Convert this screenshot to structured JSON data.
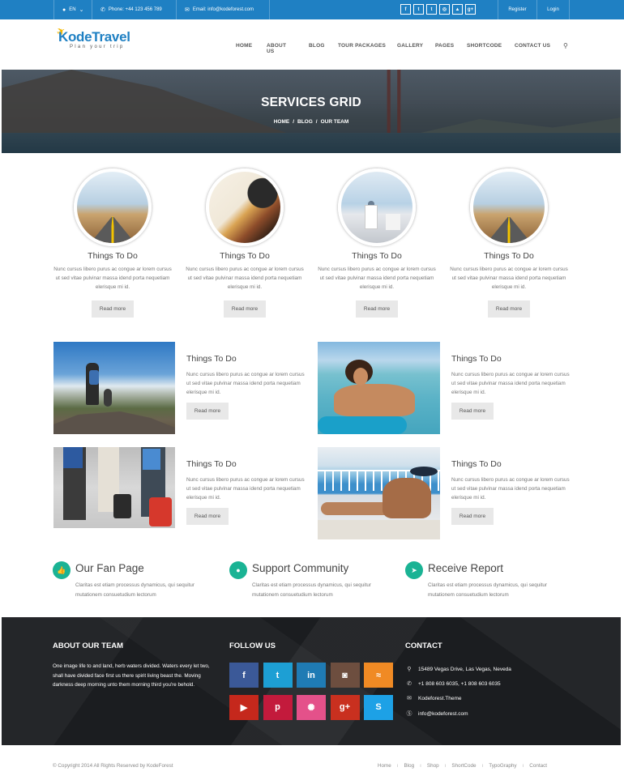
{
  "topbar": {
    "lang": "EN",
    "phone": "Phone: +44 123 456 789",
    "email": "Email: info@kodeforest.com",
    "socials": [
      "f",
      "t",
      "t",
      "◎",
      "▲",
      "g+"
    ],
    "register": "Register",
    "login": "Login"
  },
  "header": {
    "logo_word": "KodeTravel",
    "logo_tagline": "Plan your trip",
    "nav": [
      "HOME",
      "ABOUT US",
      "BLOG",
      "TOUR PACKAGES",
      "GALLERY",
      "PAGES",
      "SHORTCODE",
      "CONTACT US"
    ]
  },
  "hero": {
    "title": "SERVICES GRID",
    "breadcrumb": [
      "HOME",
      "BLOG",
      "OUR TEAM"
    ]
  },
  "circle_cards": [
    {
      "title": "Things To Do",
      "text": "Nunc cursus libero purus ac congue ar lorem cursus ut sed vitae pulvinar massa idend porta nequetiam elerisque mi id.",
      "button": "Read more"
    },
    {
      "title": "Things To Do",
      "text": "Nunc cursus libero purus ac congue ar lorem cursus ut sed vitae pulvinar massa idend porta nequetiam elerisque mi id.",
      "button": "Read more"
    },
    {
      "title": "Things To Do",
      "text": "Nunc cursus libero purus ac congue ar lorem cursus ut sed vitae pulvinar massa idend porta nequetiam elerisque mi id.",
      "button": "Read more"
    },
    {
      "title": "Things To Do",
      "text": "Nunc cursus libero purus ac congue ar lorem cursus ut sed vitae pulvinar massa idend porta nequetiam elerisque mi id.",
      "button": "Read more"
    }
  ],
  "image_cards": [
    {
      "title": "Things To Do",
      "text": "Nunc cursus libero purus ac congue ar lorem cursus ut sed vitae pulvinar massa idend porta nequetiam elerisque mi id.",
      "button": "Read more"
    },
    {
      "title": "Things To Do",
      "text": "Nunc cursus libero purus ac congue ar lorem cursus ut sed vitae pulvinar massa idend porta nequetiam elerisque mi id.",
      "button": "Read more"
    },
    {
      "title": "Things To Do",
      "text": "Nunc cursus libero purus ac congue ar lorem cursus ut sed vitae pulvinar massa idend porta nequetiam elerisque mi id.",
      "button": "Read more"
    },
    {
      "title": "Things To Do",
      "text": "Nunc cursus libero purus ac congue ar lorem cursus ut sed vitae pulvinar massa idend porta nequetiam elerisque mi id.",
      "button": "Read more"
    }
  ],
  "features": [
    {
      "icon": "thumbs-up-icon",
      "title": "Our Fan Page",
      "text": "Claritas est etiam processus dynamicus, qui sequitur mutationem consuetudium lectorum"
    },
    {
      "icon": "chat-bubble-icon",
      "title": "Support Community",
      "text": "Claritas est etiam processus dynamicus, qui sequitur mutationem consuetudium lectorum"
    },
    {
      "icon": "send-icon",
      "title": "Receive Report",
      "text": "Claritas est etiam processus dynamicus, qui sequitur mutationem consuetudium lectorum"
    }
  ],
  "footer": {
    "about_title": "ABOUT OUR TEAM",
    "about_text": "One image life to and land, herb waters divided. Waters every let two, shall have divided face first us there spirit living beast the. Moving darkness deep morning unto them morning third you're behold.",
    "follow_title": "FOLLOW US",
    "follow_tiles": [
      {
        "name": "facebook-tile",
        "glyph": "f",
        "color": "#3b5998"
      },
      {
        "name": "twitter-tile",
        "glyph": "t",
        "color": "#1d9fd4"
      },
      {
        "name": "linkedin-tile",
        "glyph": "in",
        "color": "#1f7bb4"
      },
      {
        "name": "instagram-tile",
        "glyph": "◙",
        "color": "#6d4e3f"
      },
      {
        "name": "rss-tile",
        "glyph": "≈",
        "color": "#f08a24"
      },
      {
        "name": "youtube-tile",
        "glyph": "▶",
        "color": "#c5281c"
      },
      {
        "name": "pinterest-tile",
        "glyph": "p",
        "color": "#c31a3c"
      },
      {
        "name": "dribbble-tile",
        "glyph": "✺",
        "color": "#e4518a"
      },
      {
        "name": "googleplus-tile",
        "glyph": "g+",
        "color": "#c9301f"
      },
      {
        "name": "skype-tile",
        "glyph": "S",
        "color": "#1da1e6"
      }
    ],
    "contact_title": "CONTACT",
    "contact": [
      {
        "icon": "location-pin-icon",
        "text": "15489 Vegas Drive, Las Vegas, Neveda"
      },
      {
        "icon": "phone-icon",
        "text": "+1 808 603 6035, +1 808 603 6035"
      },
      {
        "icon": "mail-icon",
        "text": "Kodeforest.Theme"
      },
      {
        "icon": "skype-icon",
        "text": "info@kodeforest.com"
      }
    ]
  },
  "bottom": {
    "copyright": "© Copyright 2014 All Rights Reserved by KodeForest",
    "links": [
      "Home",
      "Blog",
      "Shop",
      "ShortCode",
      "TypoGraphy",
      "Contact"
    ]
  },
  "colors": {
    "topbar": "#1f80c3",
    "accent_green": "#1ab394",
    "footer_bg": "#1b1d20"
  }
}
